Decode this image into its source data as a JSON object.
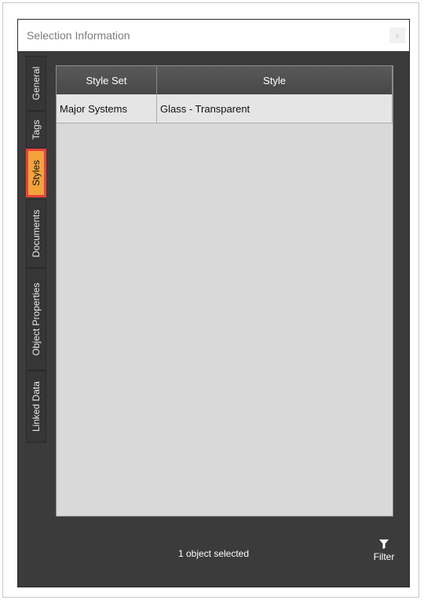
{
  "window": {
    "title": "Selection Information",
    "close_label": "x"
  },
  "tabs": [
    {
      "label": "General",
      "active": false
    },
    {
      "label": "Tags",
      "active": false
    },
    {
      "label": "Styles",
      "active": true
    },
    {
      "label": "Documents",
      "active": false
    },
    {
      "label": "Object Properties",
      "active": false
    },
    {
      "label": "Linked Data",
      "active": false
    }
  ],
  "table": {
    "headers": [
      "Style Set",
      "Style"
    ],
    "rows": [
      [
        "Major Systems",
        "Glass - Transparent"
      ]
    ]
  },
  "status": {
    "text": "1 object selected"
  },
  "filter": {
    "label": "Filter",
    "icon": "filter-icon"
  },
  "colors": {
    "active_tab": "#f2a33a",
    "active_tab_outline": "#e8413c",
    "panel_bg": "#3b3b3b"
  }
}
